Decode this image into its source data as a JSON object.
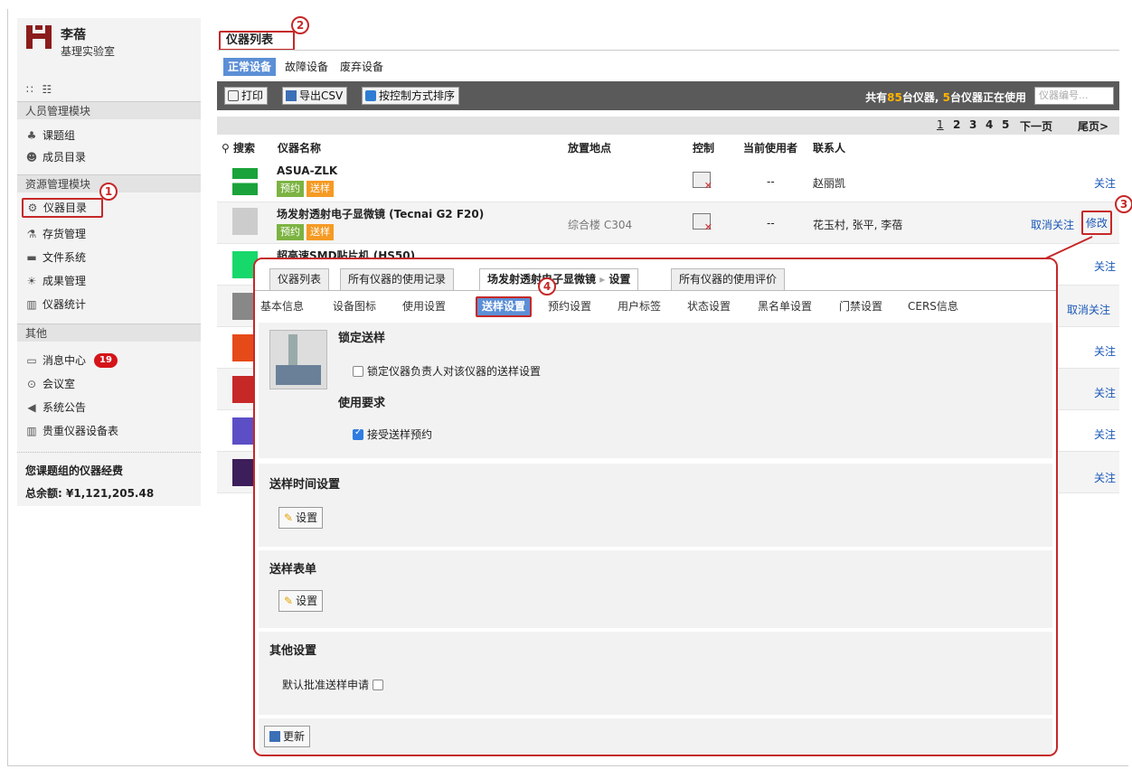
{
  "colors": {
    "accent": "#5b8fd6",
    "annotation": "#c62828",
    "brand": "#8b1c1c",
    "link": "#1a57b8",
    "toolbar": "#5a5a5a"
  },
  "sidebar": {
    "user_name": "李蓓",
    "lab_name": "基理实验室",
    "view_icons": "∷ ☷",
    "sections": [
      {
        "label": "人员管理模块"
      },
      {
        "label": "资源管理模块"
      },
      {
        "label": "其他"
      }
    ],
    "items": [
      {
        "label": "课题组",
        "icon": "tree-icon"
      },
      {
        "label": "成员目录",
        "icon": "members-icon"
      },
      {
        "label": "仪器目录",
        "icon": "gear-icon"
      },
      {
        "label": "存货管理",
        "icon": "flask-icon"
      },
      {
        "label": "文件系统",
        "icon": "folder-icon"
      },
      {
        "label": "成果管理",
        "icon": "award-icon"
      },
      {
        "label": "仪器统计",
        "icon": "bar-chart-icon"
      },
      {
        "label": "消息中心",
        "icon": "message-icon",
        "badge": "19"
      },
      {
        "label": "会议室",
        "icon": "meeting-icon"
      },
      {
        "label": "系统公告",
        "icon": "megaphone-icon"
      },
      {
        "label": "贵重仪器设备表",
        "icon": "bar-chart-icon"
      }
    ],
    "funds_title": "您课题组的仪器经费",
    "funds_label": "总余额:",
    "funds_value": "¥1,121,205.48"
  },
  "annotations": [
    "1",
    "2",
    "3",
    "4"
  ],
  "main": {
    "tab": "仪器列表",
    "subtabs": [
      "正常设备",
      "故障设备",
      "废弃设备"
    ],
    "toolbar": {
      "print": "打印",
      "export": "导出CSV",
      "sort": "按控制方式排序",
      "info_prefix": "共有",
      "info_count": "85",
      "info_mid": "台仪器,",
      "info_inuse": "5",
      "info_suffix": "台仪器正在使用",
      "search_placeholder": "仪器编号..."
    },
    "pager": {
      "pages": [
        "1",
        "2",
        "3",
        "4",
        "5"
      ],
      "next": "下一页",
      "last": "尾页>"
    },
    "headers": {
      "search": "搜索",
      "name": "仪器名称",
      "location": "放置地点",
      "control": "控制",
      "current_user": "当前使用者",
      "contact": "联系人"
    },
    "rows": [
      {
        "name": "ASUA-ZLK",
        "tags": [
          "预约",
          "送样"
        ],
        "location": "",
        "current_user": "--",
        "contact": "赵丽凯",
        "actions": [
          "关注"
        ]
      },
      {
        "name": "场发射透射电子显微镜 (Tecnai G2 F20)",
        "tags": [
          "预约",
          "送样"
        ],
        "location": "综合楼 C304",
        "current_user": "--",
        "contact": "花玉村, 张平, 李蓓",
        "actions": [
          "取消关注",
          "修改"
        ]
      },
      {
        "name": "超高速SMD贴片机 (HS50)",
        "actions": [
          "关注"
        ]
      },
      {
        "actions": [
          "取消关注"
        ]
      },
      {
        "actions": [
          "关注"
        ]
      },
      {
        "actions": [
          "关注"
        ]
      },
      {
        "actions": [
          "关注"
        ]
      },
      {
        "actions": [
          "关注"
        ]
      }
    ]
  },
  "callout": {
    "tabs": [
      "仪器列表",
      "所有仪器的使用记录",
      "场发射透射电子显微镜",
      "设置",
      "所有仪器的使用评价"
    ],
    "subtabs": [
      "基本信息",
      "设备图标",
      "使用设置",
      "送样设置",
      "预约设置",
      "用户标签",
      "状态设置",
      "黑名单设置",
      "门禁设置",
      "CERS信息"
    ],
    "lock_title": "锁定送样",
    "lock_option": "锁定仪器负责人对该仪器的送样设置",
    "req_title": "使用要求",
    "req_option": "接受送样预约",
    "time_title": "送样时间设置",
    "form_title": "送样表单",
    "other_title": "其他设置",
    "other_option": "默认批准送样申请",
    "set_button": "设置",
    "update_button": "更新"
  }
}
